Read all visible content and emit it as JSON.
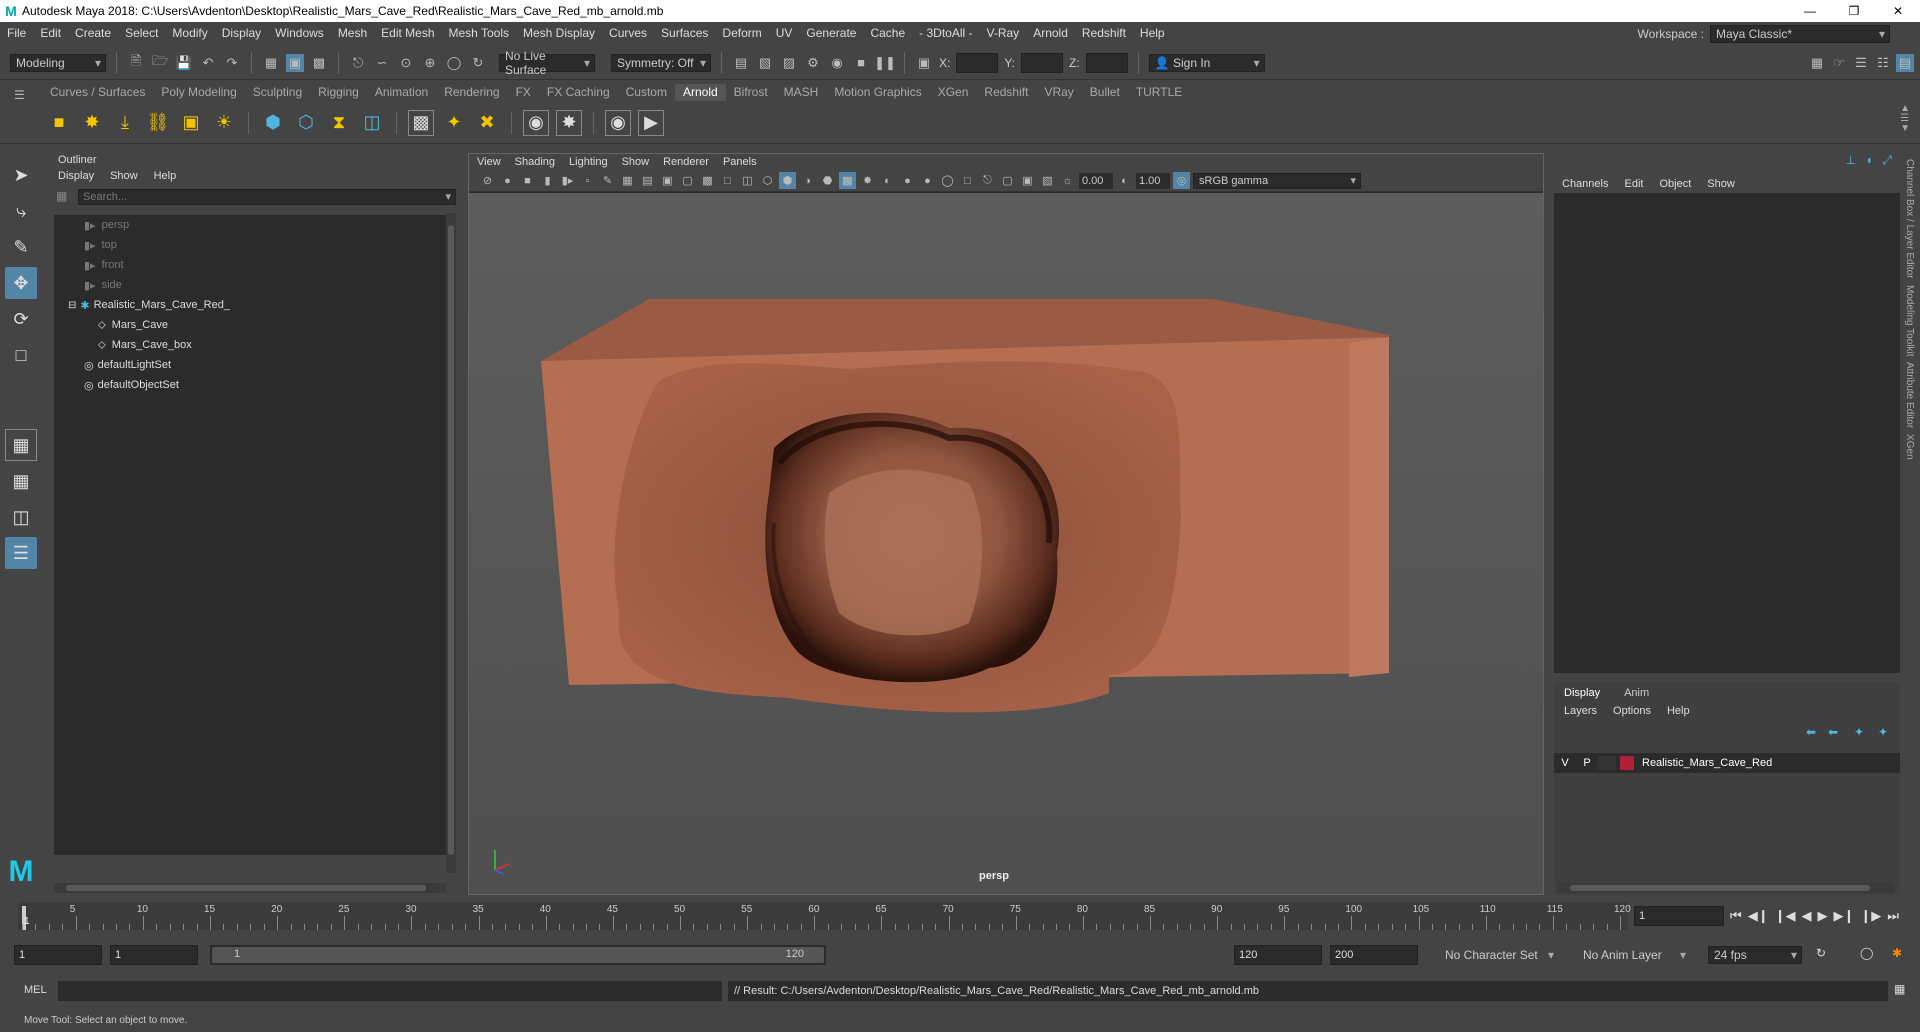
{
  "window": {
    "title": "Autodesk Maya 2018: C:\\Users\\Avdenton\\Desktop\\Realistic_Mars_Cave_Red\\Realistic_Mars_Cave_Red_mb_arnold.mb"
  },
  "menu": [
    "File",
    "Edit",
    "Create",
    "Select",
    "Modify",
    "Display",
    "Windows",
    "Mesh",
    "Edit Mesh",
    "Mesh Tools",
    "Mesh Display",
    "Curves",
    "Surfaces",
    "Deform",
    "UV",
    "Generate",
    "Cache",
    "- 3DtoAll -",
    "V-Ray",
    "Arnold",
    "Redshift",
    "Help"
  ],
  "workspace": {
    "label": "Workspace :",
    "value": "Maya Classic*"
  },
  "status": {
    "mode": "Modeling",
    "live_surface": "No Live Surface",
    "symmetry": "Symmetry: Off",
    "x": "X:",
    "y": "Y:",
    "z": "Z:",
    "sign_in": "Sign In"
  },
  "shelf_tabs": [
    "Curves / Surfaces",
    "Poly Modeling",
    "Sculpting",
    "Rigging",
    "Animation",
    "Rendering",
    "FX",
    "FX Caching",
    "Custom",
    "Arnold",
    "Bifrost",
    "MASH",
    "Motion Graphics",
    "XGen",
    "Redshift",
    "VRay",
    "Bullet",
    "TURTLE"
  ],
  "active_shelf": "Arnold",
  "outliner": {
    "title": "Outliner",
    "menu": [
      "Display",
      "Show",
      "Help"
    ],
    "search_placeholder": "Search...",
    "items": [
      {
        "label": "persp",
        "indent": 0,
        "dim": true,
        "icon": "camera-icon"
      },
      {
        "label": "top",
        "indent": 0,
        "dim": true,
        "icon": "camera-icon"
      },
      {
        "label": "front",
        "indent": 0,
        "dim": true,
        "icon": "camera-icon"
      },
      {
        "label": "side",
        "indent": 0,
        "dim": true,
        "icon": "camera-icon"
      },
      {
        "label": "Realistic_Mars_Cave_Red_",
        "indent": 0,
        "dim": false,
        "icon": "group-icon"
      },
      {
        "label": "Mars_Cave",
        "indent": 1,
        "dim": false,
        "icon": "mesh-icon"
      },
      {
        "label": "Mars_Cave_box",
        "indent": 1,
        "dim": false,
        "icon": "mesh-icon"
      },
      {
        "label": "defaultLightSet",
        "indent": 0,
        "dim": false,
        "icon": "set-icon"
      },
      {
        "label": "defaultObjectSet",
        "indent": 0,
        "dim": false,
        "icon": "set-icon"
      }
    ]
  },
  "viewport": {
    "menu": [
      "View",
      "Shading",
      "Lighting",
      "Show",
      "Renderer",
      "Panels"
    ],
    "exposure": "0.00",
    "gamma": "1.00",
    "colorspace": "sRGB gamma",
    "camera": "persp"
  },
  "channel_box": {
    "menu": [
      "Channels",
      "Edit",
      "Object",
      "Show"
    ],
    "layer_tabs": [
      "Display",
      "Anim"
    ],
    "layer_menu": [
      "Layers",
      "Options",
      "Help"
    ],
    "layer": {
      "v": "V",
      "p": "P",
      "name": "Realistic_Mars_Cave_Red",
      "color": "#b0203a"
    }
  },
  "side_tabs": [
    "Channel Box / Layer Editor",
    "Modeling Toolkit",
    "Attribute Editor",
    "XGen"
  ],
  "timeline": {
    "ticks": [
      "5",
      "10",
      "15",
      "20",
      "25",
      "30",
      "35",
      "40",
      "45",
      "50",
      "55",
      "60",
      "65",
      "70",
      "75",
      "80",
      "85",
      "90",
      "95",
      "100",
      "105",
      "110",
      "115",
      "120"
    ],
    "current": "1",
    "current_marker": "1"
  },
  "range": {
    "start": "1",
    "playback_start": "1",
    "slider_start": "1",
    "slider_end": "120",
    "playback_end": "120",
    "end": "200",
    "character_set": "No Character Set",
    "anim_layer": "No Anim Layer",
    "fps": "24 fps"
  },
  "command": {
    "lang": "MEL",
    "result": "// Result: C:/Users/Avdenton/Desktop/Realistic_Mars_Cave_Red/Realistic_Mars_Cave_Red_mb_arnold.mb"
  },
  "help_line": "Move Tool: Select an object to move."
}
